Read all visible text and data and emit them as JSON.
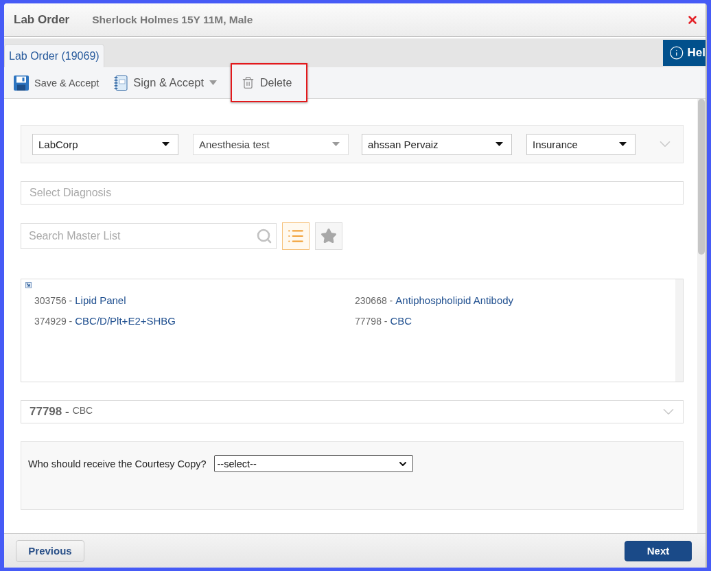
{
  "dialog": {
    "title": "Lab Order",
    "patient": "Sherlock Holmes 15Y 11M, Male"
  },
  "tabs": [
    {
      "label": "Lab Order (19069)",
      "selected": true
    }
  ],
  "help_button": {
    "label": "Hel"
  },
  "toolbar": [
    {
      "kind": "save",
      "label": "Save & Accept",
      "dropdown": false,
      "highlighted": false
    },
    {
      "kind": "sign",
      "label": "Sign & Accept",
      "dropdown": true,
      "highlighted": false
    },
    {
      "kind": "delete",
      "label": "Delete",
      "dropdown": false,
      "highlighted": true
    }
  ],
  "filters": [
    {
      "kind": "select",
      "value": "LabCorp"
    },
    {
      "kind": "combo",
      "value": "Anesthesia test"
    },
    {
      "kind": "select",
      "value": "ahssan Pervaiz"
    },
    {
      "kind": "select",
      "value": "Insurance"
    }
  ],
  "diagnosis": {
    "placeholder": "Select Diagnosis"
  },
  "master_search": {
    "placeholder": "Search Master List"
  },
  "view_buttons": [
    {
      "kind": "list",
      "selected": true
    },
    {
      "kind": "favorites",
      "selected": false
    }
  ],
  "selected_tests": [
    {
      "code": "303756 -",
      "name": "Lipid Panel"
    },
    {
      "code": "230668 -",
      "name": "Antiphospholipid Antibody"
    },
    {
      "code": "374929 -",
      "name": "CBC/D/Plt+E2+SHBG"
    },
    {
      "code": "77798 -",
      "name": "CBC"
    }
  ],
  "test_detail": {
    "code": "77798 -",
    "name": "CBC",
    "expanded": false
  },
  "courtesy_copy": {
    "label": "Who should receive the Courtesy Copy?",
    "value": "--select--"
  },
  "footer": {
    "previous": "Previous",
    "next": "Next"
  }
}
